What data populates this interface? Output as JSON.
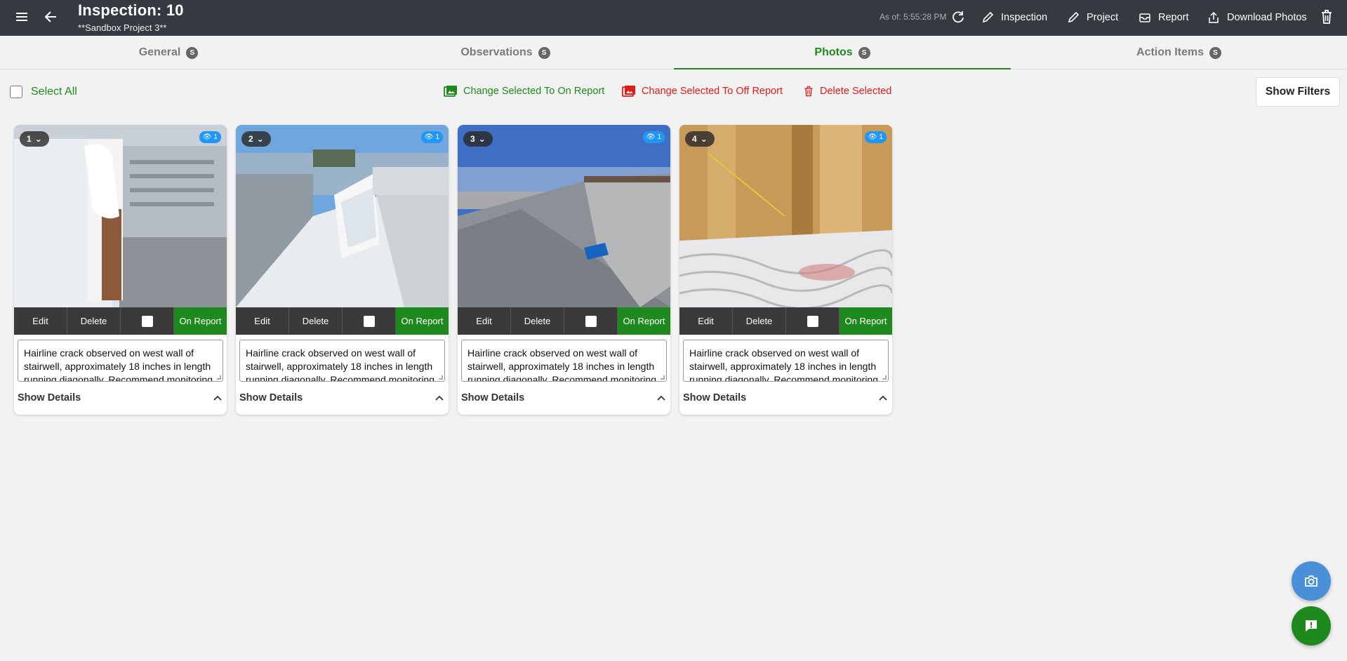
{
  "header": {
    "title": "Inspection: 10",
    "subtitle": "**Sandbox Project 3**",
    "as_of": "As of: 5:55:28 PM",
    "actions": {
      "inspection": "Inspection",
      "project": "Project",
      "report": "Report",
      "download_photos": "Download Photos"
    }
  },
  "tabs": [
    {
      "label": "General",
      "badge": "S"
    },
    {
      "label": "Observations",
      "badge": "S"
    },
    {
      "label": "Photos",
      "badge": "S",
      "active": true
    },
    {
      "label": "Action Items",
      "badge": "S"
    }
  ],
  "toolbar": {
    "select_all": "Select All",
    "on_report": "Change Selected To On Report",
    "off_report": "Change Selected To Off Report",
    "delete_selected": "Delete Selected",
    "show_filters": "Show Filters"
  },
  "photos": [
    {
      "number": "1",
      "views": "1",
      "edit": "Edit",
      "delete": "Delete",
      "status": "On Report",
      "description": "Hairline crack observed on west wall of stairwell, approximately 18 inches in length running diagonally. Recommend monitoring",
      "details": "Show Details"
    },
    {
      "number": "2",
      "views": "1",
      "edit": "Edit",
      "delete": "Delete",
      "status": "On Report",
      "description": "Hairline crack observed on west wall of stairwell, approximately 18 inches in length running diagonally. Recommend monitoring",
      "details": "Show Details"
    },
    {
      "number": "3",
      "views": "1",
      "edit": "Edit",
      "delete": "Delete",
      "status": "On Report",
      "description": "Hairline crack observed on west wall of stairwell, approximately 18 inches in length running diagonally. Recommend monitoring",
      "details": "Show Details"
    },
    {
      "number": "4",
      "views": "1",
      "edit": "Edit",
      "delete": "Delete",
      "status": "On Report",
      "description": "Hairline crack observed on west wall of stairwell, approximately 18 inches in length running diagonally. Recommend monitoring",
      "details": "Show Details"
    }
  ],
  "colors": {
    "topbar": "#343a40",
    "accent_green": "#1e8a1e",
    "danger_red": "#e31b1b",
    "fab_blue": "#4a90d9"
  }
}
